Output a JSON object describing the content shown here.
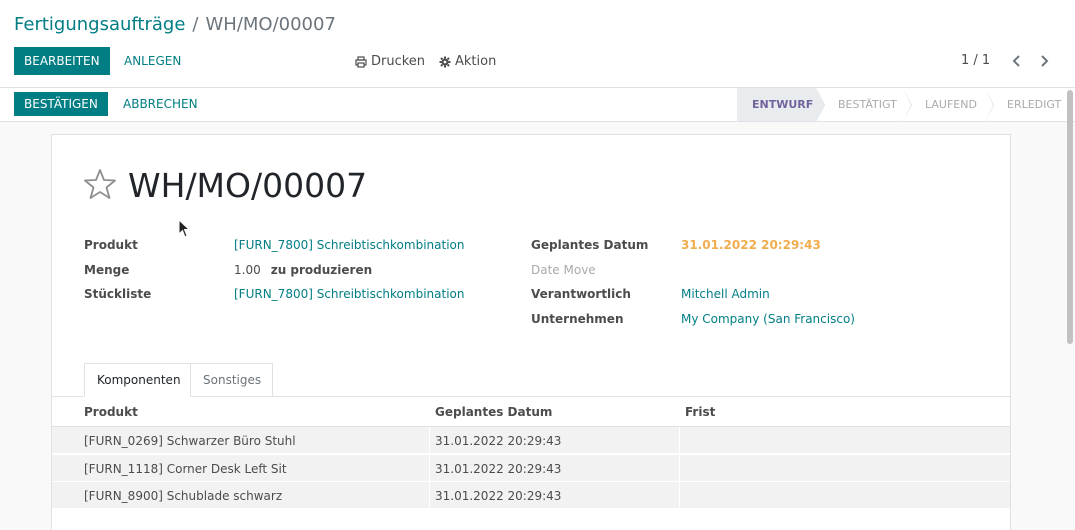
{
  "breadcrumb": {
    "parent": "Fertigungsaufträge",
    "separator": "/",
    "current": "WH/MO/00007"
  },
  "toolbar": {
    "edit_label": "Bearbeiten",
    "create_label": "Anlegen",
    "print_label": "Drucken",
    "action_label": "Aktion",
    "pager": "1 / 1"
  },
  "statusbar": {
    "confirm_label": "Bestätigen",
    "cancel_label": "Abbrechen",
    "stages": [
      "Entwurf",
      "Bestätigt",
      "Laufend",
      "Erledigt"
    ],
    "active_stage": "Entwurf"
  },
  "record": {
    "title": "WH/MO/00007",
    "fields_left": {
      "product_label": "Produkt",
      "product_value": "[FURN_7800] Schreibtischkombination",
      "qty_label": "Menge",
      "qty_value": "1.00",
      "qty_unit": "zu produzieren",
      "bom_label": "Stückliste",
      "bom_value": "[FURN_7800] Schreibtischkombination"
    },
    "fields_right": {
      "planned_label": "Geplantes Datum",
      "planned_value": "31.01.2022 20:29:43",
      "date_move_label": "Date Move",
      "responsible_label": "Verantwortlich",
      "responsible_value": "Mitchell Admin",
      "company_label": "Unternehmen",
      "company_value": "My Company (San Francisco)"
    }
  },
  "tabs": [
    "Komponenten",
    "Sonstiges"
  ],
  "components_table": {
    "headers": [
      "Produkt",
      "Geplantes Datum",
      "Frist"
    ],
    "rows": [
      {
        "product": "[FURN_0269] Schwarzer Büro Stuhl",
        "date": "31.01.2022 20:29:43",
        "deadline": ""
      },
      {
        "product": "[FURN_1118] Corner Desk Left Sit",
        "date": "31.01.2022 20:29:43",
        "deadline": ""
      },
      {
        "product": "[FURN_8900] Schublade schwarz",
        "date": "31.01.2022 20:29:43",
        "deadline": ""
      }
    ]
  },
  "colors": {
    "primary": "#017e84",
    "planned_date": "#f0ad4e",
    "active_stage": "#71639e"
  },
  "icons": {
    "print": "print-icon",
    "action": "gear-icon",
    "favorite": "star-icon",
    "prev": "chevron-left-icon",
    "next": "chevron-right-icon"
  }
}
